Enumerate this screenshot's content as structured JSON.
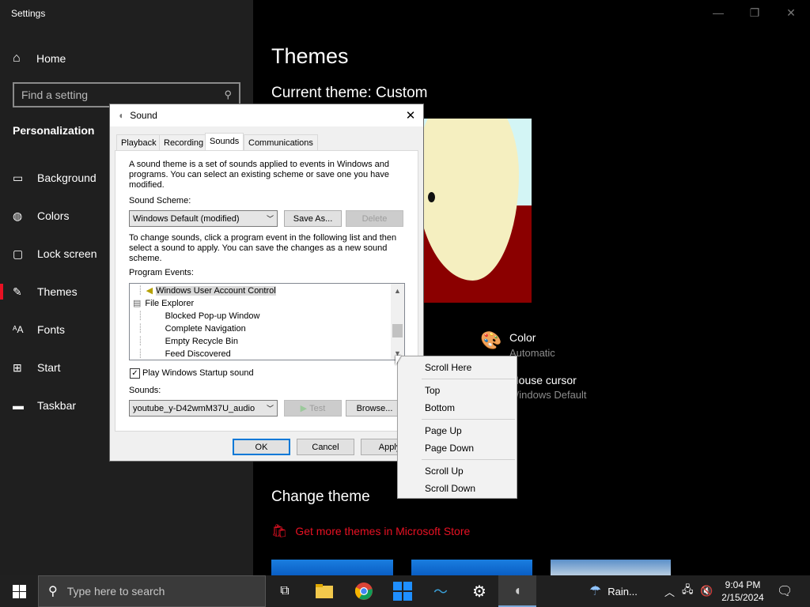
{
  "app_title": "Settings",
  "window_controls": {
    "minimize": "—",
    "restore": "❐",
    "close": "✕"
  },
  "sidebar": {
    "home": "Home",
    "search_placeholder": "Find a setting",
    "section": "Personalization",
    "items": [
      {
        "label": "Background",
        "icon": "image-icon"
      },
      {
        "label": "Colors",
        "icon": "palette-icon"
      },
      {
        "label": "Lock screen",
        "icon": "lock-screen-icon"
      },
      {
        "label": "Themes",
        "icon": "brush-icon"
      },
      {
        "label": "Fonts",
        "icon": "font-icon"
      },
      {
        "label": "Start",
        "icon": "start-grid-icon"
      },
      {
        "label": "Taskbar",
        "icon": "taskbar-icon"
      }
    ]
  },
  "main": {
    "title": "Themes",
    "current_theme": "Current theme: Custom",
    "color_title": "Color",
    "color_value": "Automatic",
    "cursor_title": "Mouse cursor",
    "cursor_value": "Windows Default",
    "change_theme": "Change theme",
    "store_link": "Get more themes in Microsoft Store"
  },
  "dialog": {
    "title": "Sound",
    "tabs": [
      "Playback",
      "Recording",
      "Sounds",
      "Communications"
    ],
    "selected_tab": "Sounds",
    "intro": "A sound theme is a set of sounds applied to events in Windows and programs.  You can select an existing scheme or save one you have modified.",
    "scheme_label": "Sound Scheme:",
    "scheme_value": "Windows Default (modified)",
    "save_as": "Save As...",
    "delete": "Delete",
    "instructions": "To change sounds, click a program event in the following list and then select a sound to apply.  You can save the changes as a new sound scheme.",
    "events_label": "Program Events:",
    "events": [
      "Windows User Account Control",
      "File Explorer",
      "Blocked Pop-up Window",
      "Complete Navigation",
      "Empty Recycle Bin",
      "Feed Discovered"
    ],
    "startup_checkbox": "Play Windows Startup sound",
    "startup_checked": true,
    "sounds_label": "Sounds:",
    "sounds_value": "youtube_y-D42wmM37U_audio",
    "test": "Test",
    "browse": "Browse...",
    "ok": "OK",
    "cancel": "Cancel",
    "apply": "Apply"
  },
  "context_menu": {
    "items": [
      [
        "Scroll Here"
      ],
      [
        "Top",
        "Bottom"
      ],
      [
        "Page Up",
        "Page Down"
      ],
      [
        "Scroll Up",
        "Scroll Down"
      ]
    ]
  },
  "taskbar": {
    "search_placeholder": "Type here to search",
    "weather": "Rain...",
    "time": "9:04 PM",
    "date": "2/15/2024"
  },
  "colors": {
    "accent": "#e81123",
    "sidebar_bg": "#1f1f1f",
    "taskbar_bg": "#202020"
  }
}
